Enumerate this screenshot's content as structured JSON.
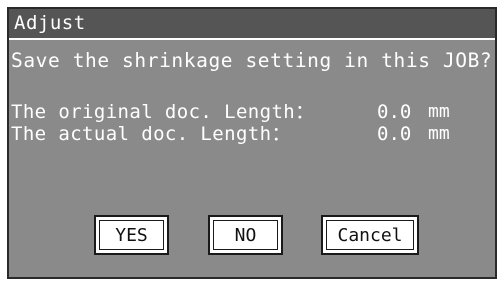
{
  "dialog": {
    "title": "Adjust",
    "question": "Save the shrinkage setting in this JOB?",
    "rows": [
      {
        "label": "The original doc. Length：",
        "value": "0.0",
        "unit": "mm"
      },
      {
        "label": "The actual doc. Length：",
        "value": "0.0",
        "unit": "mm"
      }
    ],
    "buttons": {
      "yes": "YES",
      "no": "NO",
      "cancel": "Cancel"
    }
  },
  "colors": {
    "panel_background": "#8a8a8a",
    "titlebar_background": "#555555",
    "text": "#ffffff",
    "button_background": "#ffffff",
    "button_text": "#111111",
    "border": "#1a1a1a"
  }
}
